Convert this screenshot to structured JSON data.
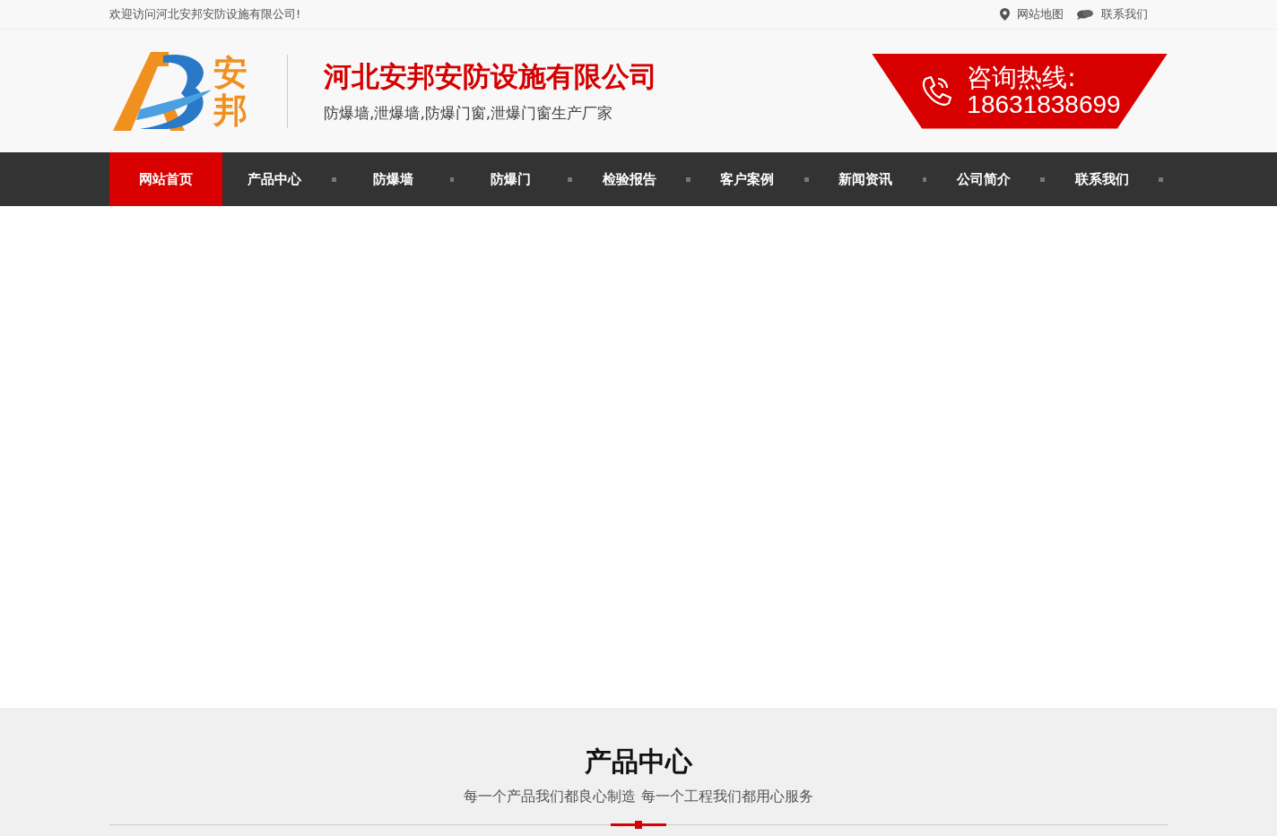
{
  "top_bar": {
    "welcome": "欢迎访问河北安邦安防设施有限公司!",
    "links": [
      {
        "kind": "map",
        "label": "网站地图"
      },
      {
        "kind": "chat",
        "label": "联系我们"
      }
    ]
  },
  "header": {
    "logo_text": "安邦",
    "company_name": "河北安邦安防设施有限公司",
    "tagline": "防爆墙,泄爆墙,防爆门窗,泄爆门窗生产厂家",
    "hotline": {
      "label": "咨询热线:",
      "number": "18631838699"
    }
  },
  "nav": [
    {
      "label": "网站首页",
      "selected": true
    },
    {
      "label": "产品中心",
      "selected": false
    },
    {
      "label": "防爆墙",
      "selected": false
    },
    {
      "label": "防爆门",
      "selected": false
    },
    {
      "label": "检验报告",
      "selected": false
    },
    {
      "label": "客户案例",
      "selected": false
    },
    {
      "label": "新闻资讯",
      "selected": false
    },
    {
      "label": "公司简介",
      "selected": false
    },
    {
      "label": "联系我们",
      "selected": false
    }
  ],
  "products_section": {
    "title": "产品中心",
    "subtitle": "每一个产品我们都良心制造 每一个工程我们都用心服务"
  }
}
